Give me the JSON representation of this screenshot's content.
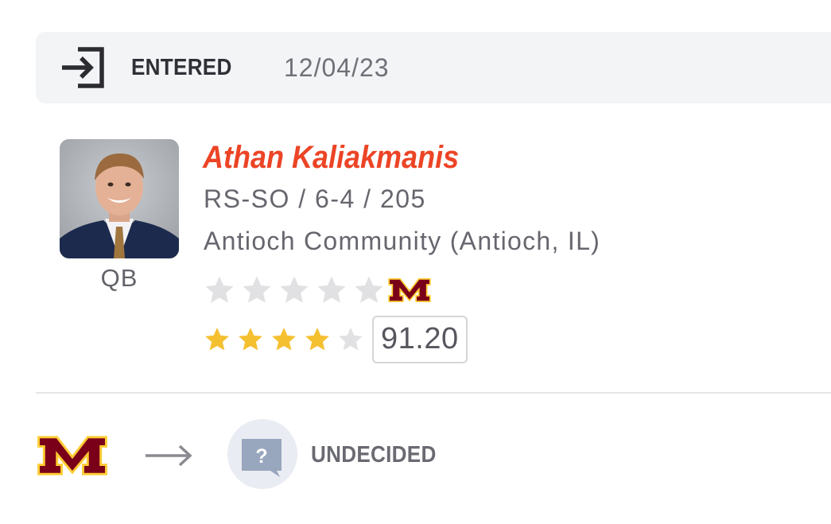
{
  "status": {
    "icon": "enter-icon",
    "label": "ENTERED",
    "date": "12/04/23"
  },
  "player": {
    "photo": "player-headshot",
    "position": "QB",
    "name": "Athan Kaliakmanis",
    "meta": "RS-SO / 6-4 / 205",
    "school": "Antioch Community (Antioch, IL)",
    "transfer_stars": {
      "filled": 0,
      "total": 5
    },
    "prospect_stars": {
      "filled": 4,
      "total": 5
    },
    "rating": "91.20"
  },
  "transfer": {
    "from_logo": "minnesota-m-logo",
    "arrow_icon": "arrow-right-icon",
    "destination_icon": "question-bubble-icon",
    "destination_label": "UNDECIDED"
  },
  "colors": {
    "name": "#ec4425",
    "maroon": "#7a0019",
    "gold": "#f5c030",
    "star_empty": "#e1e1e3"
  }
}
